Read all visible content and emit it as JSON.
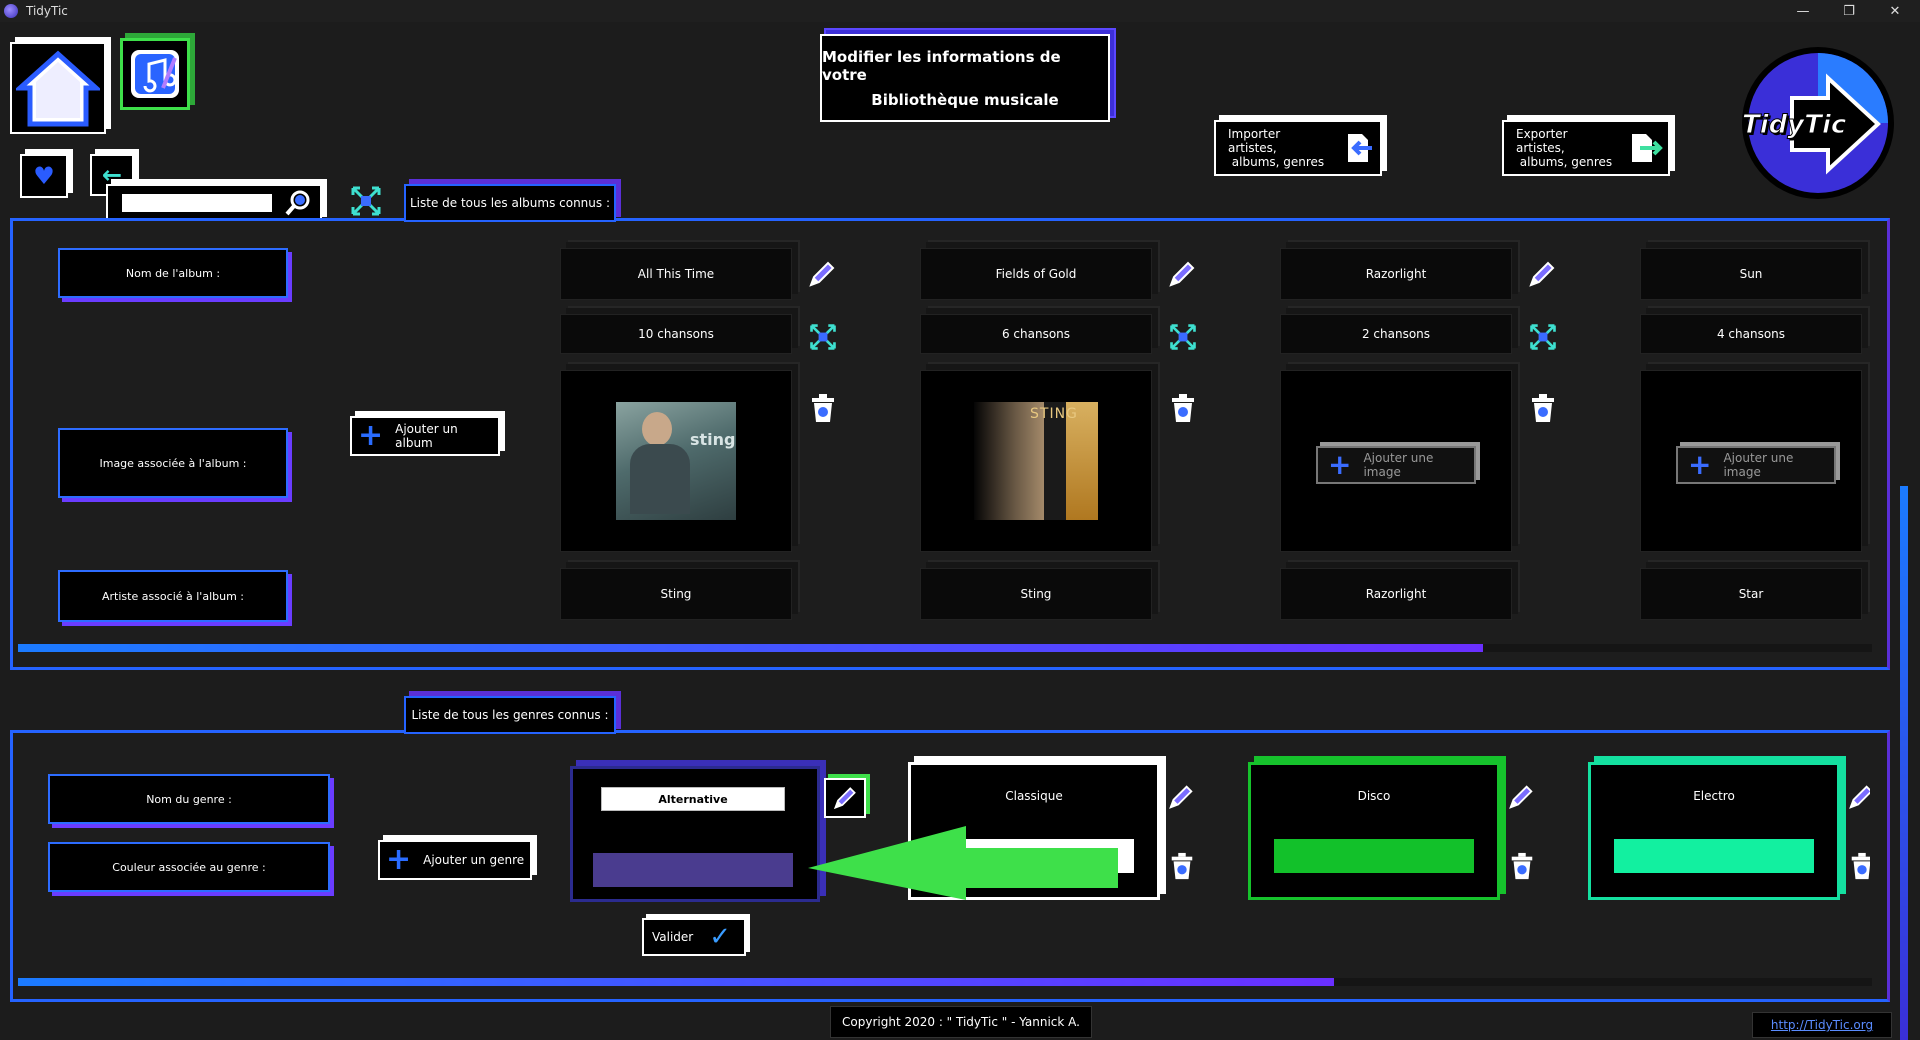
{
  "window": {
    "title": "TidyTic",
    "minimize": "—",
    "maximize": "❐",
    "close": "✕"
  },
  "header": {
    "title_line1": "Modifier les informations de votre",
    "title_line2": "Bibliothèque musicale",
    "import_label_1": "Importer artistes,",
    "import_label_2": "albums, genres",
    "export_label_1": "Exporter artistes,",
    "export_label_2": "albums, genres",
    "logo_text": "TidyTic"
  },
  "search": {
    "value": "",
    "placeholder": ""
  },
  "albums_section": {
    "tab_label": "Liste de tous les albums connus :",
    "row_labels": {
      "name": "Nom de l'album :",
      "image": "Image associée à l'album :",
      "artist": "Artiste associé à l'album :"
    },
    "add_album": "Ajouter un album",
    "add_image": "Ajouter une image",
    "albums": [
      {
        "name": "All This Time",
        "songs": "10 chansons",
        "artist": "Sting",
        "cover_text": "sting"
      },
      {
        "name": "Fields of Gold",
        "songs": "6 chansons",
        "artist": "Sting",
        "cover_text": "STING"
      },
      {
        "name": "Razorlight",
        "songs": "2 chansons",
        "artist": "Razorlight"
      },
      {
        "name": "Sun",
        "songs": "4 chansons",
        "artist": "Star"
      }
    ],
    "scroll_progress": 0.79
  },
  "genres_section": {
    "tab_label": "Liste de tous les genres connus :",
    "row_labels": {
      "name": "Nom du genre :",
      "color": "Couleur associée au genre :"
    },
    "add_genre": "Ajouter un genre",
    "validate": "Valider",
    "edit_value": "Alternative",
    "genres": [
      {
        "name": "Alternative",
        "color": "#4a3c8f",
        "border": "#2b2b8f"
      },
      {
        "name": "Classique",
        "color": "#ffffff",
        "border": "#ffffff"
      },
      {
        "name": "Disco",
        "color": "#12c12a",
        "border": "#16c22c"
      },
      {
        "name": "Electro",
        "color": "#12f0a0",
        "border": "#14e0a0"
      }
    ],
    "scroll_progress": 0.71
  },
  "footer": {
    "copyright": "Copyright 2020 : \" TidyTic \" - Yannick A.",
    "url": "http://TidyTic.org"
  },
  "colors": {
    "accent_blue": "#2563ff",
    "accent_purple": "#5b2fd8",
    "arrow_green": "#3ee04a"
  }
}
